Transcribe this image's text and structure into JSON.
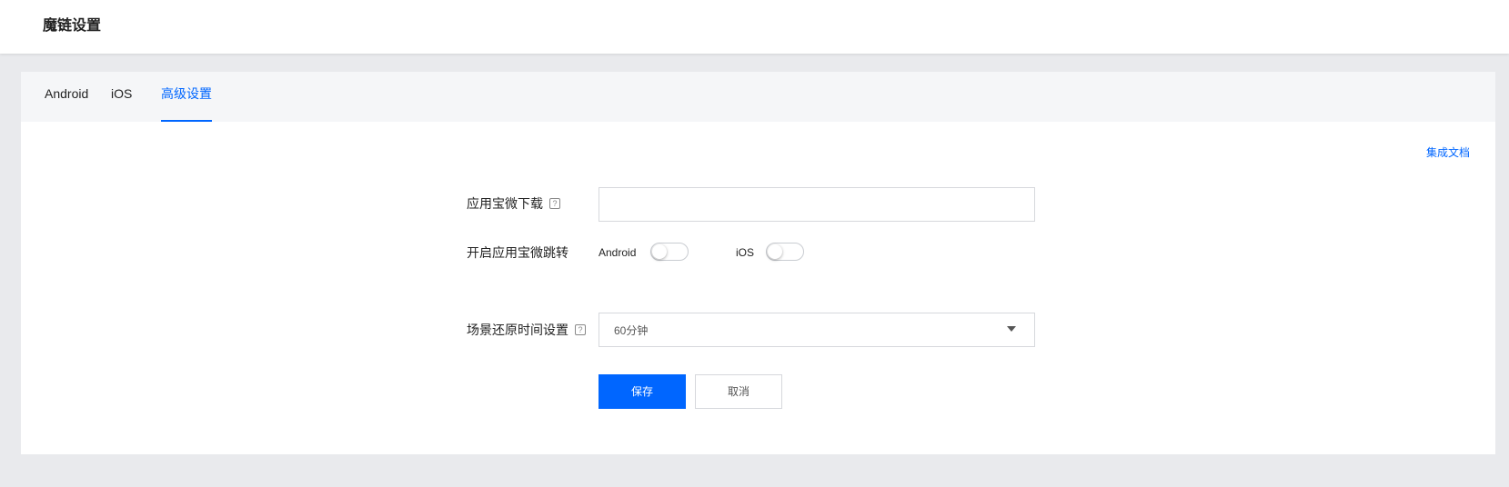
{
  "header": {
    "title": "魔链设置"
  },
  "tabs": [
    {
      "label": "Android",
      "active": false
    },
    {
      "label": "iOS",
      "active": false
    },
    {
      "label": "高级设置",
      "active": true
    }
  ],
  "doc_link": "集成文档",
  "form": {
    "download": {
      "label": "应用宝微下载",
      "help_icon": "question-icon",
      "value": "",
      "placeholder": ""
    },
    "redirect": {
      "label": "开启应用宝微跳转",
      "android_label": "Android",
      "android_on": false,
      "ios_label": "iOS",
      "ios_on": false
    },
    "restore": {
      "label": "场景还原时间设置",
      "help_icon": "question-icon",
      "selected": "60分钟"
    }
  },
  "buttons": {
    "save": "保存",
    "cancel": "取消"
  },
  "colors": {
    "accent": "#0066ff",
    "background": "#e9eaed",
    "tabbar": "#f5f6f8"
  }
}
